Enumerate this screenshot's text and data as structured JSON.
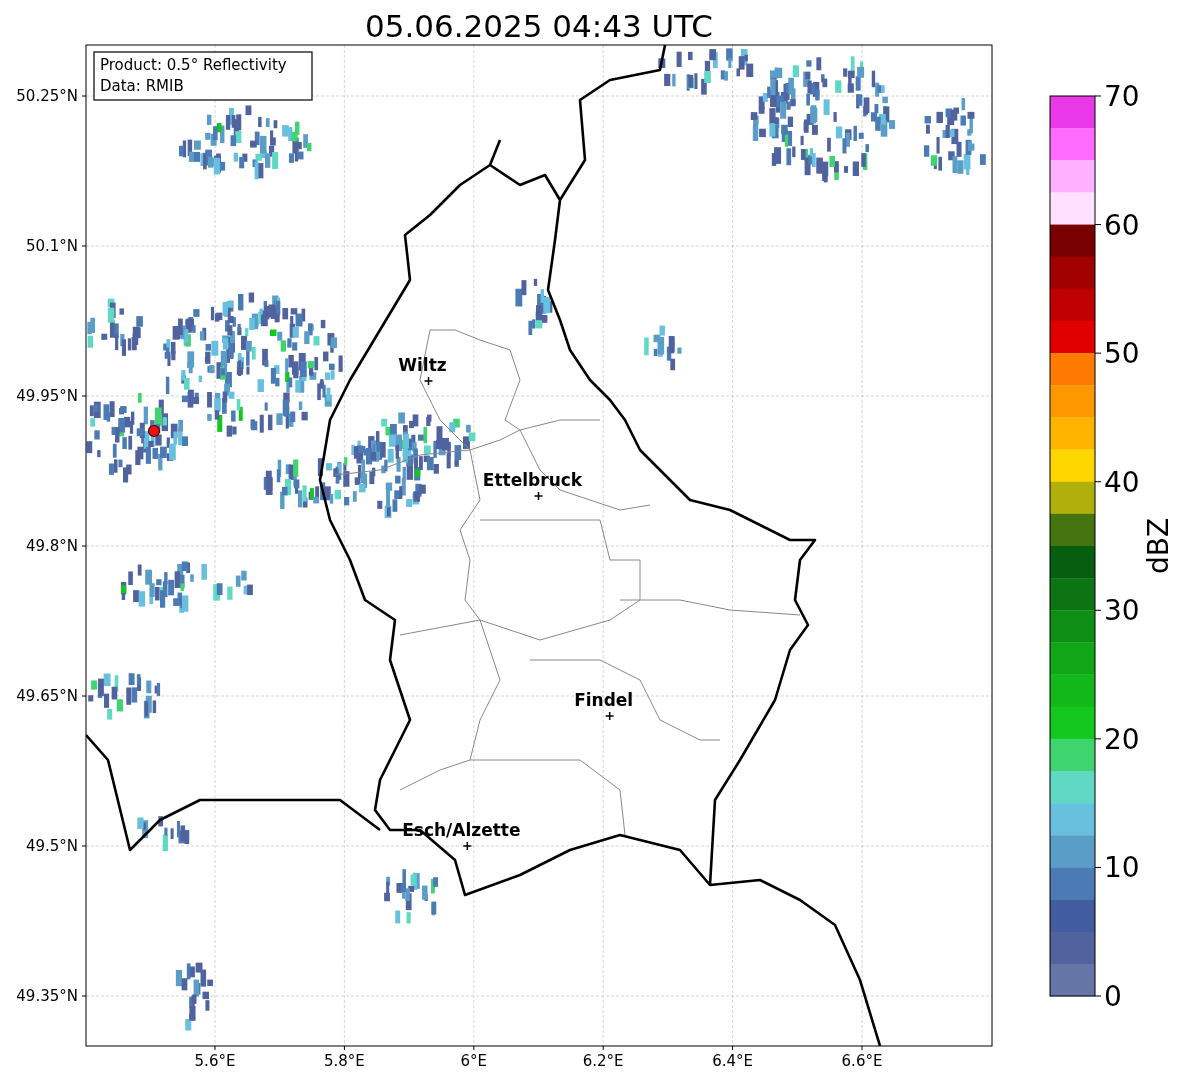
{
  "title": "05.06.2025 04:43 UTC",
  "info_box": [
    "Product: 0.5° Reflectivity",
    "Data: RMIB"
  ],
  "map": {
    "cities": [
      "Wiltz",
      "Ettelbruck",
      "Findel",
      "Esch/Alzette"
    ],
    "yticks": [
      "50.25°N",
      "50.1°N",
      "49.95°N",
      "49.8°N",
      "49.65°N",
      "49.5°N",
      "49.35°N"
    ],
    "xticks": [
      "5.6°E",
      "5.8°E",
      "6°E",
      "6.2°E",
      "6.4°E",
      "6.6°E"
    ]
  },
  "colorbar": {
    "ticks": [
      "70",
      "60",
      "50",
      "40",
      "30",
      "20",
      "10",
      "0"
    ],
    "label": "dBZ",
    "bins": [
      {
        "color": "#e838e8"
      },
      {
        "color": "#ff6cff"
      },
      {
        "color": "#ffb0ff"
      },
      {
        "color": "#ffe0ff"
      },
      {
        "color": "#780000"
      },
      {
        "color": "#a00000"
      },
      {
        "color": "#c00000"
      },
      {
        "color": "#e00000"
      },
      {
        "color": "#ff7a00"
      },
      {
        "color": "#ff9800"
      },
      {
        "color": "#ffb400"
      },
      {
        "color": "#ffd700"
      },
      {
        "color": "#b0b00a"
      },
      {
        "color": "#44730f"
      },
      {
        "color": "#085e10"
      },
      {
        "color": "#0c7412"
      },
      {
        "color": "#0e8e14"
      },
      {
        "color": "#10a616"
      },
      {
        "color": "#12b81a"
      },
      {
        "color": "#12c81e"
      },
      {
        "color": "#3ed46e"
      },
      {
        "color": "#5fd8c4"
      },
      {
        "color": "#67c0de"
      },
      {
        "color": "#5a9ec8"
      },
      {
        "color": "#4a7bb4"
      },
      {
        "color": "#415ca0"
      },
      {
        "color": "#51639e"
      },
      {
        "color": "#6475a6"
      }
    ]
  }
}
